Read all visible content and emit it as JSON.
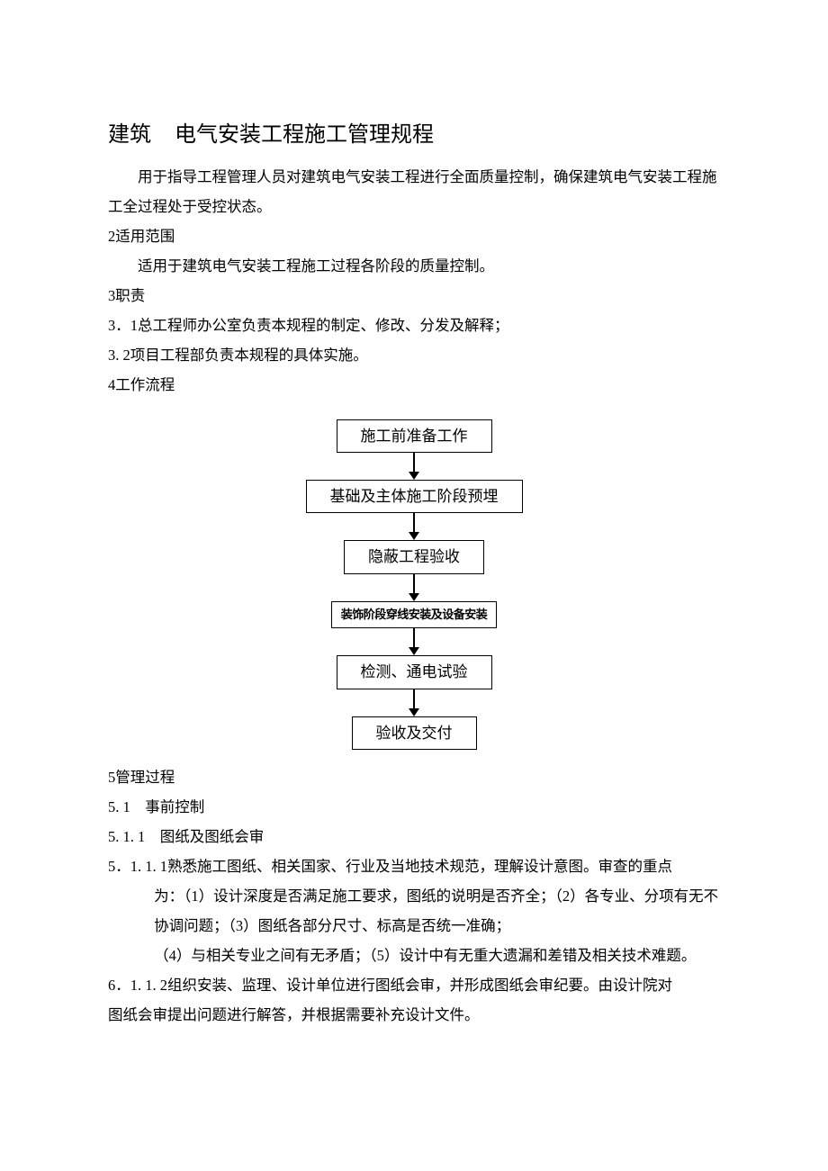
{
  "title_a": "建筑",
  "title_b": "电气安装工程施工管理规程",
  "intro": "用于指导工程管理人员对建筑电气安装工程进行全面质量控制，确保建筑电气安装工程施工全过程处于受控状态。",
  "s2_head": "2适用范围",
  "s2_body": "适用于建筑电气安装工程施工过程各阶段的质量控制。",
  "s3_head": "3职责",
  "s3_1": "3．1总工程师办公室负责本规程的制定、修改、分发及解释；",
  "s3_2": "3. 2项目工程部负责本规程的具体实施。",
  "s4_head": "4工作流程",
  "flow": {
    "n1": "施工前准备工作",
    "n2": "基础及主体施工阶段预埋",
    "n3": "隐蔽工程验收",
    "n4": "装饰阶段穿线安装及设备安装",
    "n5": "检测、通电试验",
    "n6": "验收及交付"
  },
  "s5_head": "5管理过程",
  "s5_1": "5. 1　事前控制",
  "s5_1_1": "5. 1. 1　图纸及图纸会审",
  "s5_1_1_1a": "5．1. 1. 1熟悉施工图纸、相关国家、行业及当地技术规范，理解设计意图。审查的重点",
  "s5_1_1_1b": "为：（1）设计深度是否满足施工要求，图纸的说明是否齐全；（2）各专业、分项有无不协调问题；（3）图纸各部分尺寸、标高是否统一准确；",
  "s5_1_1_1c": "（4）与相关专业之间有无矛盾；（5）设计中有无重大遗漏和差错及相关技术难题。",
  "s6_line1": "6．1. 1. 2组织安装、监理、设计单位进行图纸会审，并形成图纸会审纪要。由设计院对",
  "s6_line2": "图纸会审提出问题进行解答，并根据需要补充设计文件。"
}
